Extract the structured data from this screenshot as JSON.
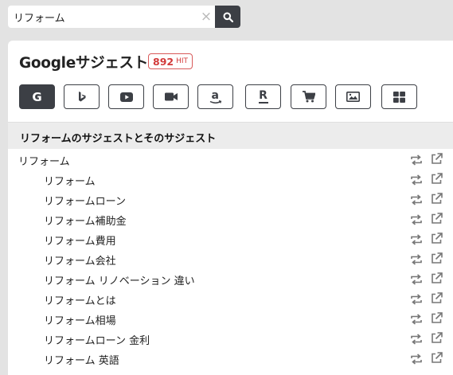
{
  "search": {
    "value": "リフォーム",
    "clear_label": "×"
  },
  "panel": {
    "title": "Googleサジェスト",
    "hit_count": "892",
    "hit_unit": "HIT"
  },
  "engines": [
    {
      "name": "google",
      "label": "G",
      "active": true
    },
    {
      "name": "bing",
      "active": false
    },
    {
      "name": "youtube",
      "active": false
    },
    {
      "name": "video",
      "active": false
    },
    {
      "name": "amazon",
      "label": "a",
      "active": false
    },
    {
      "name": "rakuten",
      "label": "R",
      "active": false
    },
    {
      "name": "shopping",
      "active": false
    },
    {
      "name": "image",
      "active": false
    },
    {
      "name": "apps",
      "active": false
    }
  ],
  "section": {
    "title": "リフォームのサジェストとそのサジェスト"
  },
  "suggestions": {
    "parent": "リフォーム",
    "children": [
      "リフォーム",
      "リフォームローン",
      "リフォーム補助金",
      "リフォーム費用",
      "リフォーム会社",
      "リフォーム リノベーション 違い",
      "リフォームとは",
      "リフォーム相場",
      "リフォームローン 金利",
      "リフォーム 英語"
    ]
  },
  "colors": {
    "dark": "#3c3f45",
    "accent": "#d23a3a",
    "icon": "#777777"
  }
}
